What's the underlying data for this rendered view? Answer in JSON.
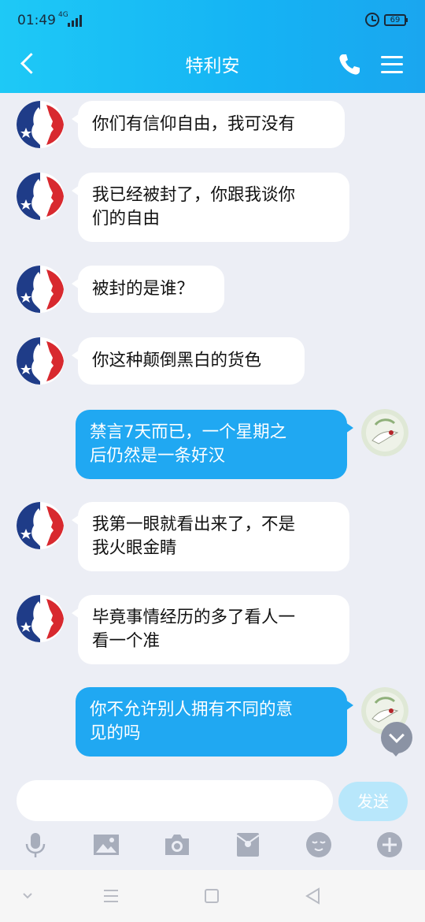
{
  "status_bar": {
    "time": "01:49",
    "network": "4G",
    "battery": "69"
  },
  "header": {
    "title": "特利安"
  },
  "messages": [
    {
      "side": "in",
      "lines": [
        "你们有信仰自由，我可没有"
      ]
    },
    {
      "side": "in",
      "lines": [
        "我已经被封了，你跟我谈你",
        "们的自由"
      ]
    },
    {
      "side": "in",
      "lines": [
        "被封的是谁？"
      ]
    },
    {
      "side": "in",
      "lines": [
        "你这种颠倒黑白的货色"
      ]
    },
    {
      "side": "out",
      "lines": [
        "禁言7天而已，一个星期之",
        "后仍然是一条好汉"
      ]
    },
    {
      "side": "in",
      "lines": [
        "我第一眼就看出来了，不是",
        "我火眼金睛"
      ]
    },
    {
      "side": "in",
      "lines": [
        "毕竟事情经历的多了看人一",
        "看一个准"
      ]
    },
    {
      "side": "out",
      "lines": [
        "你不允许别人拥有不同的意",
        "见的吗"
      ]
    }
  ],
  "composer": {
    "input_value": "",
    "send_label": "发送"
  },
  "toolbar_icons": [
    "microphone-icon",
    "image-icon",
    "camera-icon",
    "red-envelope-icon",
    "emoji-icon",
    "plus-icon"
  ],
  "colors": {
    "header": "#15b3f4",
    "outgoing_bubble": "#20a8f2",
    "incoming_bubble": "#ffffff",
    "background": "#eceef5",
    "send_disabled": "#b8e7fb"
  }
}
